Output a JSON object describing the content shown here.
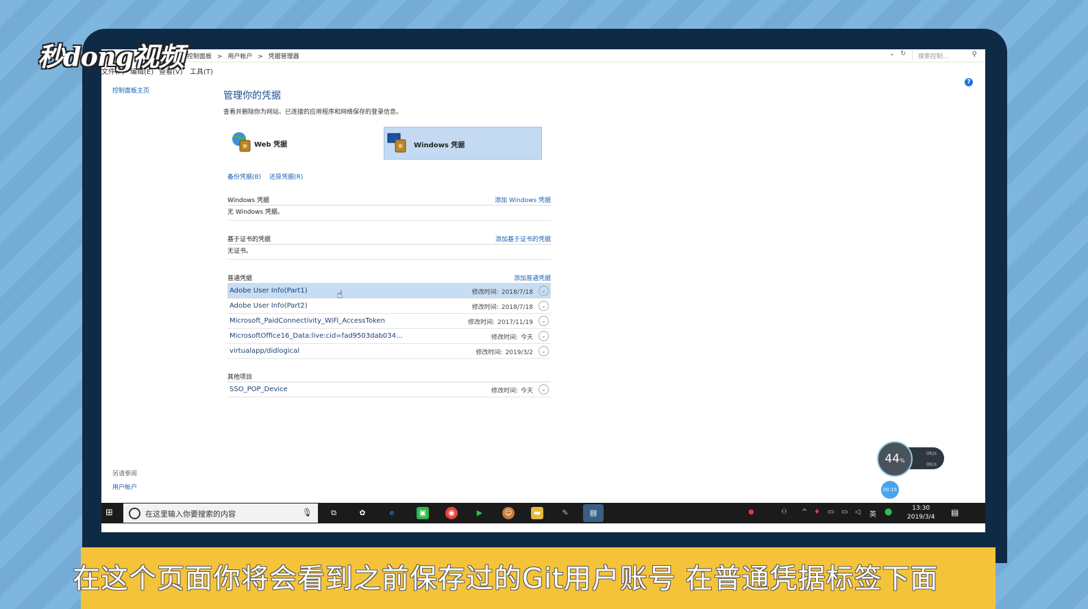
{
  "overlay": {
    "logo_text": "秒dong视频",
    "caption": "在这个页面你将会看到之前保存过的Git用户账号 在普通凭据标签下面"
  },
  "window": {
    "breadcrumbs": [
      "控制面板",
      "用户帐户",
      "凭据管理器"
    ],
    "crumb_sep": ">",
    "search_placeholder": "搜索控制...",
    "menu": [
      "文件(F)",
      "编辑(E)",
      "查看(V)",
      "工具(T)"
    ],
    "help_label": "?"
  },
  "sidebar": {
    "home_link": "控制面板主页",
    "see_also_label": "另请参阅",
    "see_also_link": "用户帐户"
  },
  "main": {
    "title": "管理你的凭据",
    "subtitle": "查看并删除你为网站、已连接的应用程序和网络保存的登录信息。",
    "categories": [
      {
        "label": "Web 凭据",
        "icon": "web-credentials-icon",
        "selected": false
      },
      {
        "label": "Windows 凭据",
        "icon": "windows-credentials-icon",
        "selected": true
      }
    ],
    "backup_label": "备份凭据(B)",
    "restore_label": "还原凭据(R)",
    "modified_label": "修改时间:",
    "sections": {
      "windows": {
        "name": "Windows 凭据",
        "add": "添加 Windows 凭据",
        "empty": "无 Windows 凭据。"
      },
      "cert": {
        "name": "基于证书的凭据",
        "add": "添加基于证书的凭据",
        "empty": "无证书。"
      },
      "generic": {
        "name": "普通凭据",
        "add": "添加普通凭据",
        "items": [
          {
            "name": "Adobe User Info(Part1)",
            "date": "2018/7/18"
          },
          {
            "name": "Adobe User Info(Part2)",
            "date": "2018/7/18"
          },
          {
            "name": "Microsoft_PaidConnectivity_WiFi_AccessToken",
            "date": "2017/11/19"
          },
          {
            "name": "MicrosoftOffice16_Data:live:cid=fad9503dab034...",
            "date": "今天"
          },
          {
            "name": "virtualapp/didlogical",
            "date": "2019/3/2"
          }
        ]
      },
      "other": {
        "name": "其他项目",
        "items": [
          {
            "name": "SSO_POP_Device",
            "date": "今天"
          }
        ]
      }
    }
  },
  "net_widget": {
    "percent": "44",
    "percent_unit": "%",
    "up": "0K/s",
    "down": "0K/s",
    "timer": "00:15"
  },
  "taskbar": {
    "search_placeholder": "在这里输入你要搜索的内容",
    "ime": "英",
    "time": "13:30",
    "date": "2019/3/4"
  },
  "colors": {
    "accent": "#1a5fb4",
    "selected_row": "#c7ddf3",
    "caption_band": "#f5c33a"
  }
}
